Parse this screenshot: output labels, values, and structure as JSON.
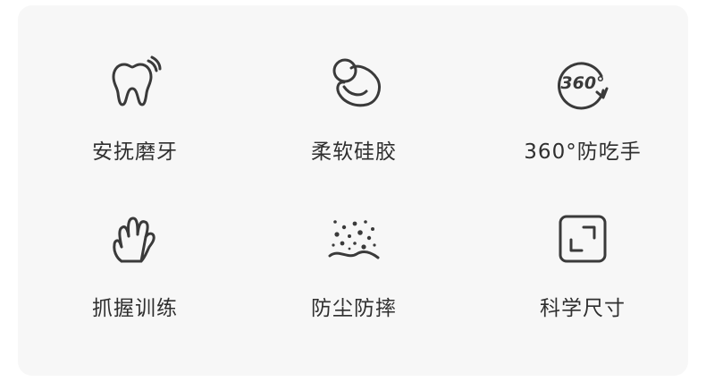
{
  "features": [
    {
      "label": "安抚磨牙",
      "icon": "tooth-icon"
    },
    {
      "label": "柔软硅胶",
      "icon": "soft-silicone-icon"
    },
    {
      "label": "360°防吃手",
      "icon": "rotate-360-icon"
    },
    {
      "label": "抓握训练",
      "icon": "hand-grip-icon"
    },
    {
      "label": "防尘防摔",
      "icon": "dust-proof-icon"
    },
    {
      "label": "科学尺寸",
      "icon": "size-frame-icon"
    }
  ],
  "icon_text": {
    "rotate_360": "360°"
  },
  "colors": {
    "panel": "#f7f7f7",
    "icon_stroke": "#3a3a3a",
    "text": "#2f2f2f"
  }
}
